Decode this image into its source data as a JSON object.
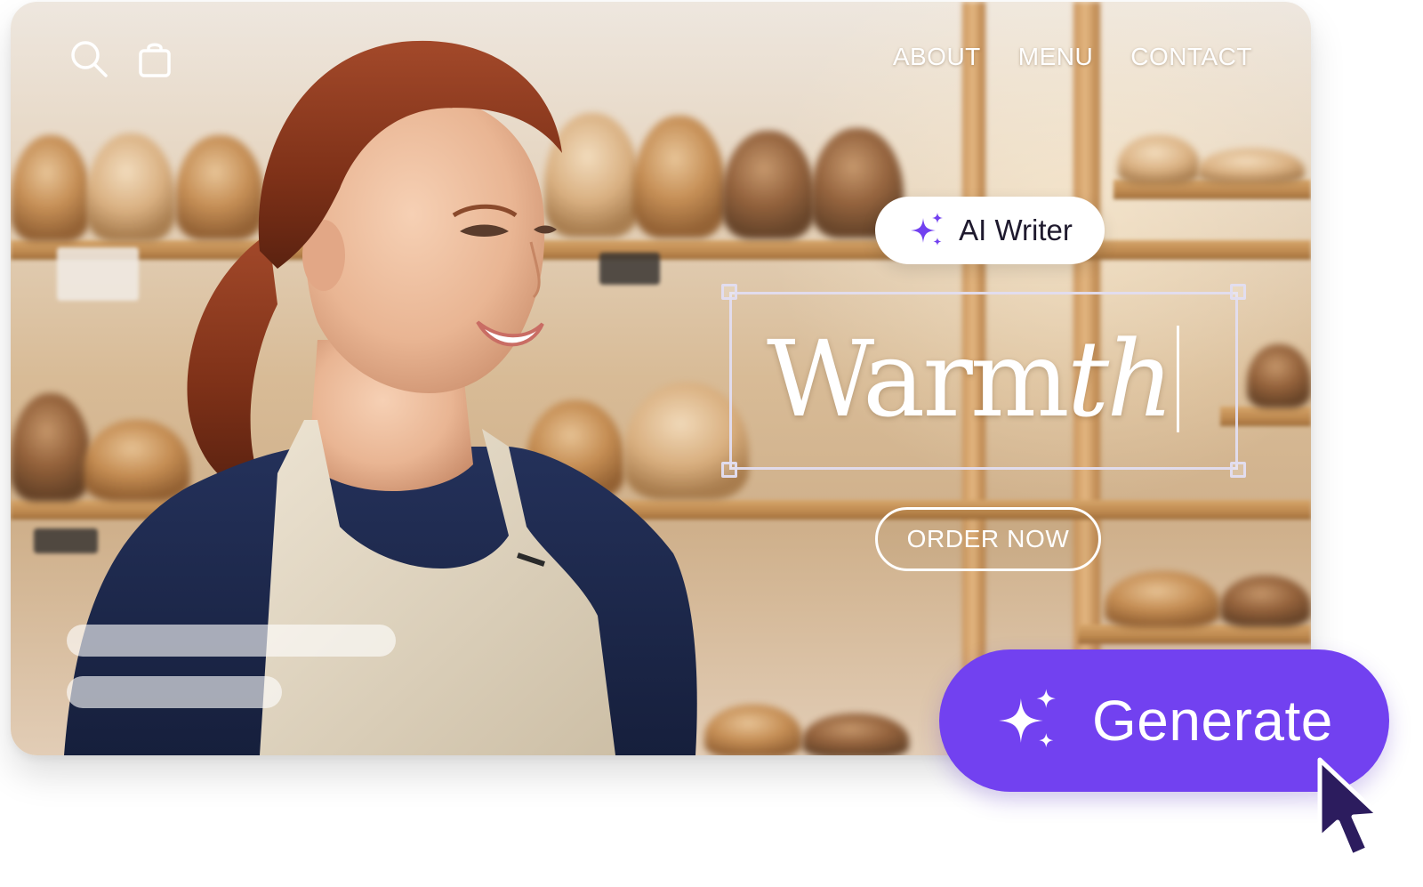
{
  "nav": {
    "left_icons": [
      "search-icon",
      "shopping-bag-icon"
    ],
    "links": [
      "ABOUT",
      "MENU",
      "CONTACT"
    ]
  },
  "ai_writer": {
    "icon": "sparkles-icon",
    "label": "AI Writer"
  },
  "headline": {
    "text_upright": "Warm",
    "text_italic": "th"
  },
  "cta": {
    "label": "ORDER NOW"
  },
  "generate": {
    "icon": "sparkles-icon",
    "label": "Generate"
  },
  "colors": {
    "accent": "#7241f0",
    "text_on_image": "#ffffff",
    "pill_text": "#1f1a2e"
  }
}
